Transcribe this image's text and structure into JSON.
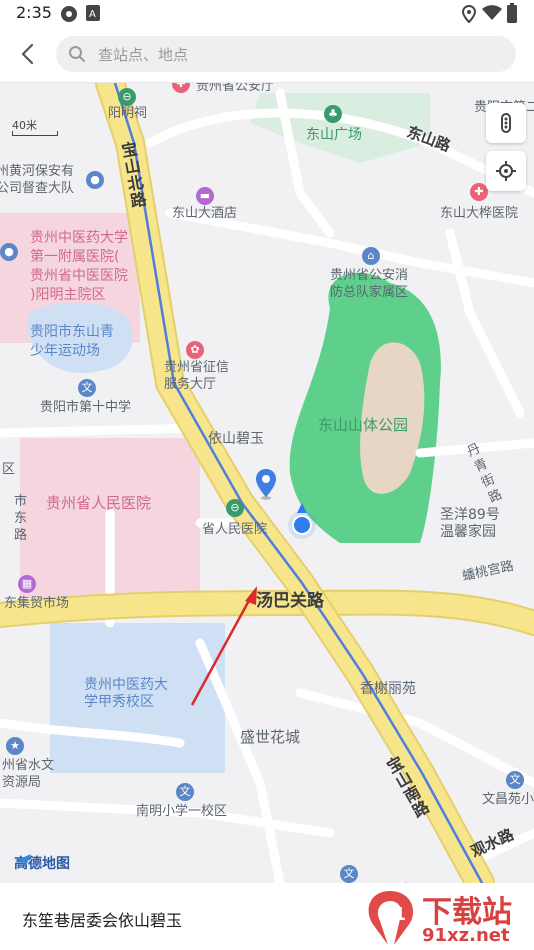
{
  "status_bar": {
    "time": "2:35"
  },
  "search": {
    "placeholder": "查站点、地点"
  },
  "map": {
    "scale_label": "40米",
    "labels": {
      "guizhou_public_security": "贵州省公安厅",
      "yangmingci": "阳明祠",
      "guiyang_no2": "贵阳市第二",
      "dongshan_square": "东山广场",
      "dongshan_road": "东山路",
      "huanghe_security": "州黄河保安有\n公司督查大队",
      "baoshan_north_road": "宝山北路",
      "dongshan_hotel": "东山大酒店",
      "dongshan_clinic": "东山大桦医院",
      "tcm_hospital_1": "贵州中医药大学\n第一附属医院(\n贵州省中医医院\n)阳明主院区",
      "fire_brigade": "贵州省公安消\n防总队家属区",
      "youth_sports": "贵阳市东山青\n少年运动场",
      "credit_hall": "贵州省征信\n服务大厅",
      "no10_middle": "贵阳市第十中学",
      "dongshan_park": "东山山体公园",
      "yishan_biyu": "依山碧玉",
      "dantai_road": "丹青街路",
      "district": "区",
      "provincial_hospital": "贵州省人民医院",
      "shidong_road": "市东路",
      "provincial_hospital_station": "省人民医院",
      "shengyang_89": "圣洋89号\n温馨家园",
      "pantao_road": "蟠桃宫路",
      "dongji_market": "东集贸市场",
      "tangbaguan_road": "汤巴关路",
      "tcm_jiaxiu": "贵州中医药大\n学甲秀校区",
      "xiangxie_liyuan": "香榭丽苑",
      "shengshi_huacheng": "盛世花城",
      "water_resources": "州省水文\n资源局",
      "baoshan_south_road": "宝山南路",
      "wenchang_garden": "文昌苑小",
      "guanshui_road": "观水路",
      "nanming_primary": "南明小学一校区"
    },
    "provider": "高德地图"
  },
  "bottom": {
    "address": "东笙巷居委会依山碧玉"
  },
  "watermark": {
    "brand": "下载站",
    "site": "91xz.net"
  },
  "colors": {
    "main_road": "#f6e58b",
    "route": "#4f7ee2",
    "park": "#5fcf8c",
    "hospital": "#f5d6de",
    "school": "#cfe0f5",
    "arrow": "#d92b2b"
  }
}
